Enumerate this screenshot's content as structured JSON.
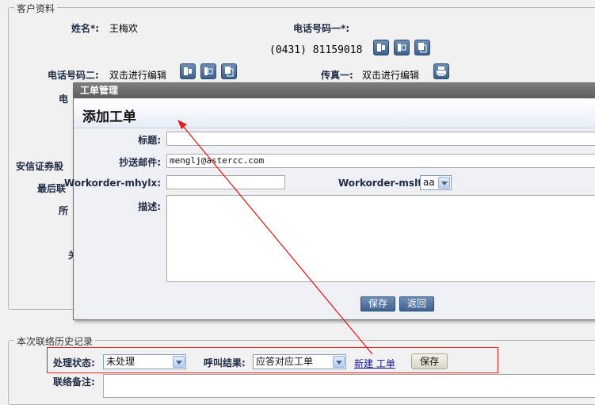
{
  "customer_section": {
    "legend": "客户资料",
    "name_label": "姓名*:",
    "name_value": "王梅欢",
    "phone1_label": "电话号码一*:",
    "phone1_value": "(0431) 81159018",
    "phone2_label": "电话号码二:",
    "phone2_value": "双击进行编辑",
    "fax1_label": "传真一:",
    "fax1_value": "双击进行编辑",
    "hidden_label_phone3": "电",
    "hidden_label_company": "安信证券股",
    "hidden_label_last_contact": "最后联",
    "hidden_label_owner": "所",
    "hidden_label_other": "关"
  },
  "modal": {
    "titlebar": "工单管理",
    "heading": "添加工单",
    "title_label": "标题:",
    "title_value": "",
    "cc_label": "抄送邮件:",
    "cc_value": "menglj@astercc.com",
    "mhylx_label": "Workorder-mhylx:",
    "mhylx_value": "",
    "mslt_label": "Workorder-mslt:",
    "mslt_value": "aa",
    "desc_label": "描述:",
    "desc_value": "",
    "save_label": "保存",
    "back_label": "返回"
  },
  "history_section": {
    "legend": "本次联络历史记录",
    "status_label": "处理状态:",
    "status_value": "未处理",
    "call_result_label": "呼叫结果:",
    "call_result_value": "应答对应工单",
    "new_ticket_link": "新建 工单",
    "save_label": "保存",
    "note_label": "联络备注:"
  },
  "colors": {
    "annotation_red": "#e02020",
    "icon_blue": "#4a6f97"
  },
  "icons": [
    "phone-icon",
    "mobile-icon",
    "copy-icon",
    "fax-icon"
  ]
}
